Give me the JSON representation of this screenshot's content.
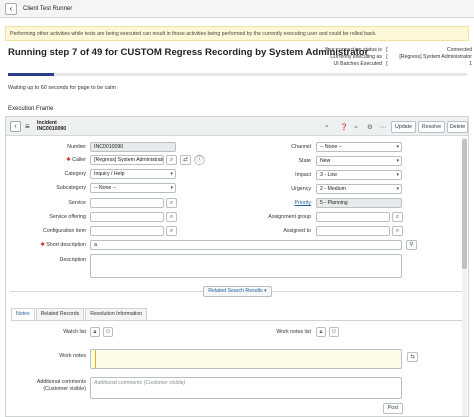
{
  "topbar": {
    "title": "Client Test Runner"
  },
  "warning": {
    "text": "Performing other activities while tests are being executed can result in those activities being performed by the currently executing user and could be rolled back."
  },
  "run": {
    "title": "Running step 7 of 49 for CUSTOM Regress Recording by System Administrator",
    "progress_fraction": 0.1,
    "wait_message": "Waiting up to 60 seconds for page to be calm"
  },
  "connection": [
    {
      "label": "Your connection status is",
      "sep": "[",
      "value": "Connected"
    },
    {
      "label": "Currently executing as",
      "sep": "[",
      "value": "[Regress] System Administrator"
    },
    {
      "label": "UI Batches Executed",
      "sep": "[",
      "value": "1"
    }
  ],
  "frame": {
    "label": "Execution Frame"
  },
  "record": {
    "type": "Incident",
    "number": "INC0010090",
    "buttons": {
      "update": "Update",
      "resolve": "Resolve",
      "delete": "Delete"
    }
  },
  "fields": {
    "number": {
      "label": "Number",
      "value": "INC0010090"
    },
    "caller": {
      "label": "Caller",
      "value": "[Regress] System Administrato"
    },
    "category": {
      "label": "Category",
      "value": "Inquiry / Help"
    },
    "subcategory": {
      "label": "Subcategory",
      "value": "-- None --"
    },
    "service": {
      "label": "Service",
      "value": ""
    },
    "service_offering": {
      "label": "Service offering",
      "value": ""
    },
    "configuration_item": {
      "label": "Configuration item",
      "value": ""
    },
    "short_description": {
      "label": "Short description",
      "value": "a"
    },
    "description": {
      "label": "Description",
      "value": ""
    },
    "channel": {
      "label": "Channel",
      "value": "-- None --"
    },
    "state": {
      "label": "State",
      "value": "New"
    },
    "impact": {
      "label": "Impact",
      "value": "3 - Low"
    },
    "urgency": {
      "label": "Urgency",
      "value": "2 - Medium"
    },
    "priority": {
      "label": "Priority",
      "value": "5 - Planning"
    },
    "assignment_group": {
      "label": "Assignment group",
      "value": ""
    },
    "assigned_to": {
      "label": "Assigned to",
      "value": ""
    }
  },
  "related_search": {
    "label": "Related Search Results"
  },
  "tabs": [
    {
      "label": "Notes"
    },
    {
      "label": "Related Records"
    },
    {
      "label": "Resolution Information"
    }
  ],
  "notes": {
    "watch_list": "Watch list",
    "work_notes_list": "Work notes list",
    "work_notes": {
      "label": "Work notes",
      "value": ""
    },
    "additional_comments": {
      "label_line1": "Additional comments",
      "label_line2": "(Customer visible)",
      "placeholder": "Additional comments (Customer visible)"
    },
    "post": "Post"
  }
}
